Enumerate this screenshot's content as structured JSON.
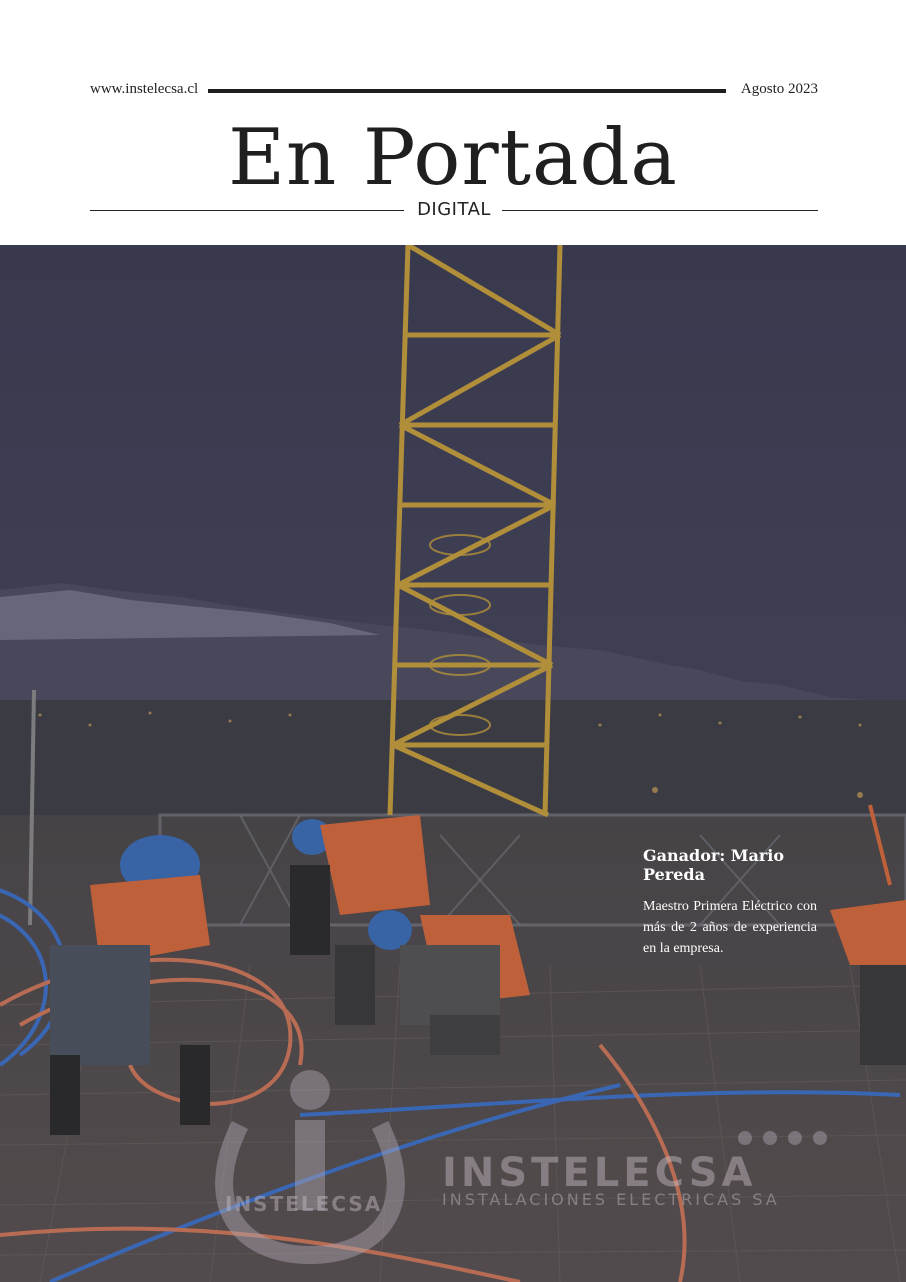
{
  "header": {
    "website": "www.instelecsa.cl",
    "date": "Agosto 2023",
    "title": "En Portada",
    "subtitle": "DIGITAL"
  },
  "caption": {
    "title": "Ganador: Mario Pereda",
    "body": "Maestro Primera Eléctrico con más de 2 años de experiencia en la empresa."
  },
  "logo": {
    "name": "INSTELECSA",
    "tagline": "INSTALACIONES ELECTRICAS SA",
    "small_name": "INSTELECSA"
  },
  "colors": {
    "sky": "#44445a",
    "crane": "#c9a23a",
    "vest": "#d96b3a",
    "conduit_blue": "#3e72c9",
    "conduit_orange": "#d27858"
  }
}
